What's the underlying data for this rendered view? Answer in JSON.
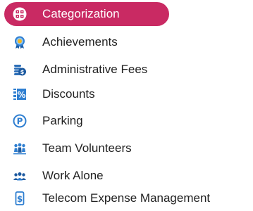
{
  "menu": {
    "active_color": "#c92a63",
    "items": [
      {
        "label": "Categorization",
        "icon": "categorization-grid-icon",
        "active": true
      },
      {
        "label": "Achievements",
        "icon": "award-badge-icon",
        "active": false
      },
      {
        "label": "Administrative Fees",
        "icon": "coins-fees-icon",
        "active": false
      },
      {
        "label": "Discounts",
        "icon": "percent-tag-icon",
        "active": false
      },
      {
        "label": "Parking",
        "icon": "parking-icon",
        "active": false
      },
      {
        "label": "Team Volunteers",
        "icon": "team-volunteers-icon",
        "active": false
      },
      {
        "label": "Work Alone",
        "icon": "work-alone-people-icon",
        "active": false
      },
      {
        "label": "Telecom Expense Management",
        "icon": "telecom-expense-icon",
        "active": false
      }
    ]
  }
}
